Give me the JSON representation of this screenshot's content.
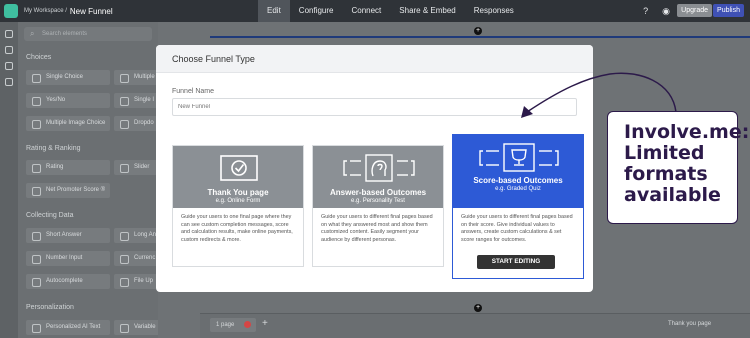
{
  "topbar": {
    "workspace": "My Workspace /",
    "funnel_name": "New Funnel",
    "tabs": [
      "Edit",
      "Configure",
      "Connect",
      "Share & Embed",
      "Responses"
    ],
    "help": "?",
    "upgrade": "Upgrade",
    "publish": "Publish"
  },
  "sidebar": {
    "search_placeholder": "Search elements",
    "sections": {
      "choices": "Choices",
      "rating": "Rating & Ranking",
      "collecting": "Collecting Data",
      "personalization": "Personalization"
    },
    "items": {
      "single_choice": "Single Choice",
      "multiple": "Multiple",
      "yes_no": "Yes/No",
      "single_image": "Single I",
      "multiple_image": "Multiple Image Choice",
      "dropdown": "Dropdo",
      "rating": "Rating",
      "slider": "Slider",
      "nps": "Net Promoter Score ®",
      "short_answer": "Short Answer",
      "long_answer": "Long An",
      "number_input": "Number Input",
      "currency": "Currenc",
      "autocomplete": "Autocomplete",
      "file_upload": "File Up",
      "personalized_ai": "Personalized AI Text",
      "variable": "Variable"
    }
  },
  "canvas": {
    "page_chip": "1 page",
    "thank_you": "Thank you page"
  },
  "modal": {
    "title": "Choose Funnel Type",
    "funnel_name_label": "Funnel Name",
    "funnel_name_placeholder": "New Funnel",
    "cards": [
      {
        "title": "Thank You page",
        "sub": "e.g. Online Form",
        "desc": "Guide your users to one final page where they can see custom completion messages, score and calculation results, make online payments, custom redirects & more."
      },
      {
        "title": "Answer-based Outcomes",
        "sub": "e.g. Personality Test",
        "desc": "Guide your users to different final pages based on what they answered most and show them customized content. Easily segment your audience by different personas."
      },
      {
        "title": "Score-based Outcomes",
        "sub": "e.g. Graded Quiz",
        "desc": "Guide your users to different final pages based on their score. Give individual values to answers, create custom calculations & set score ranges for outcomes.",
        "button": "START EDITING"
      }
    ]
  },
  "annotation": {
    "lines": [
      "Involve.me:",
      "Limited",
      "formats",
      "available"
    ]
  },
  "colors": {
    "accent": "#2d5ad6",
    "annotation": "#2c1a4a",
    "publish": "#3f51b5"
  }
}
